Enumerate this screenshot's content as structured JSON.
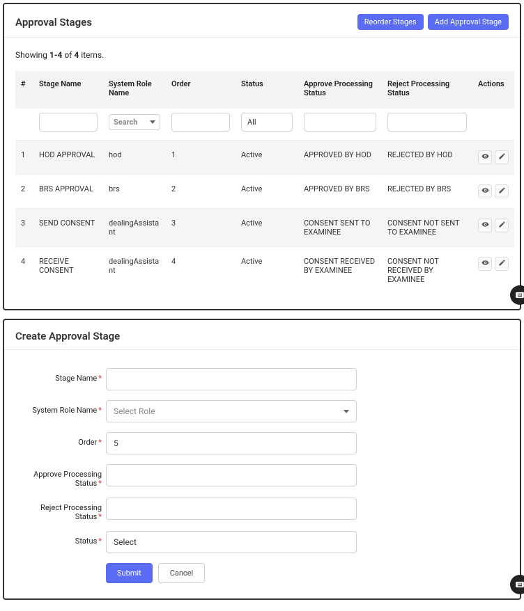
{
  "top": {
    "title": "Approval Stages",
    "reorder_btn": "Reorder Stages",
    "add_btn": "Add Approval Stage",
    "summary_prefix": "Showing ",
    "summary_range": "1-4",
    "summary_mid": " of ",
    "summary_total": "4",
    "summary_suffix": " items.",
    "columns": {
      "index": "#",
      "stage_name": "Stage Name",
      "system_role": "System Role Name",
      "order": "Order",
      "status": "Status",
      "approve_status": "Approve Processing Status",
      "reject_status": "Reject Processing Status",
      "actions": "Actions"
    },
    "filters": {
      "role_placeholder": "Search",
      "status_value": "All"
    },
    "rows": [
      {
        "idx": "1",
        "name": "HOD APPROVAL",
        "role": "hod",
        "order": "1",
        "status": "Active",
        "approve": "APPROVED BY HOD",
        "reject": "REJECTED BY HOD"
      },
      {
        "idx": "2",
        "name": "BRS APPROVAL",
        "role": "brs",
        "order": "2",
        "status": "Active",
        "approve": "APPROVED BY BRS",
        "reject": "REJECTED BY BRS"
      },
      {
        "idx": "3",
        "name": "SEND CONSENT",
        "role": "dealingAssistant",
        "order": "3",
        "status": "Active",
        "approve": "CONSENT SENT TO EXAMINEE",
        "reject": "CONSENT NOT SENT TO EXAMINEE"
      },
      {
        "idx": "4",
        "name": "RECEIVE CONSENT",
        "role": "dealingAssistant",
        "order": "4",
        "status": "Active",
        "approve": "CONSENT RECEIVED BY EXAMINEE",
        "reject": "CONSENT NOT RECEIVED BY EXAMINEE"
      }
    ]
  },
  "form": {
    "title": "Create Approval Stage",
    "labels": {
      "stage_name": "Stage Name",
      "system_role": "System Role Name",
      "order": "Order",
      "approve_status": "Approve Processing Status",
      "reject_status": "Reject Processing Status",
      "status": "Status"
    },
    "role_placeholder": "Select Role",
    "order_value": "5",
    "status_value": "Select",
    "submit": "Submit",
    "cancel": "Cancel"
  }
}
